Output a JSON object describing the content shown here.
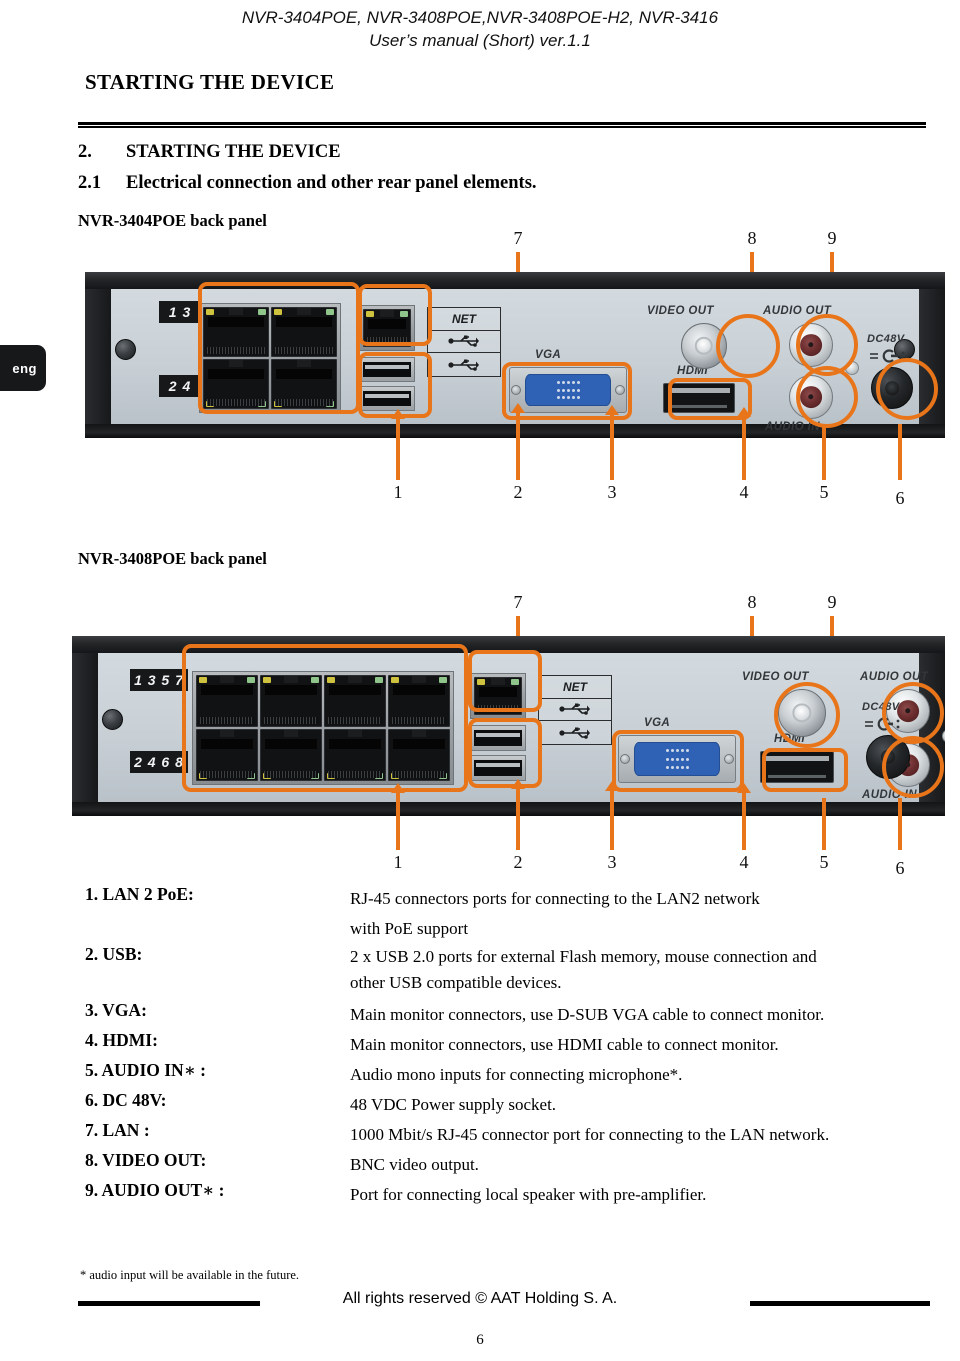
{
  "header": {
    "line1": "NVR-3404POE, NVR-3408POE,NVR-3408POE-H2, NVR-3416",
    "line2": "User’s manual (Short) ver.1.1"
  },
  "chapter_title": "STARTING THE DEVICE",
  "sections": [
    {
      "number": "2.",
      "title": "STARTING THE DEVICE"
    },
    {
      "number": "2.1",
      "title": "Electrical connection and other rear panel elements."
    }
  ],
  "language_tab": "eng",
  "panels": [
    {
      "caption": "NVR-3404POE back panel",
      "port_labels_top": "1 3",
      "port_labels_bottom": "2 4",
      "lan_ports": 4,
      "silkscreen": {
        "net": "NET",
        "vga": "VGA",
        "hdmi": "HDMI",
        "video_out": "VIDEO OUT",
        "audio_out": "AUDIO OUT",
        "audio_in": "AUDIO IN",
        "dc": "DC48V"
      },
      "callouts_top": [
        "7",
        "8",
        "9"
      ],
      "callouts_bottom": [
        "1",
        "2",
        "3",
        "4",
        "5",
        "6"
      ]
    },
    {
      "caption": "NVR-3408POE back panel",
      "port_labels_top": "1 3 5 7",
      "port_labels_bottom": "2 4 6 8",
      "lan_ports": 8,
      "silkscreen": {
        "net": "NET",
        "vga": "VGA",
        "hdmi": "HDMI",
        "video_out": "VIDEO OUT",
        "audio_out": "AUDIO OUT",
        "audio_in": "AUDIO IN",
        "dc": "DC48V"
      },
      "callouts_top": [
        "7",
        "8",
        "9"
      ],
      "callouts_bottom": [
        "1",
        "2",
        "3",
        "4",
        "5",
        "6"
      ]
    }
  ],
  "descriptions": [
    {
      "label": "1. LAN 2 PoE:",
      "text": "RJ-45 connectors ports for connecting to the LAN2 network",
      "text2": "with PoE support"
    },
    {
      "label": "2. USB:",
      "text": "2 x USB 2.0 ports for external Flash memory, mouse connection and",
      "text2": "other USB compatible devices."
    },
    {
      "label": "3. VGA:",
      "text": "Main monitor connectors, use D-SUB VGA cable to connect monitor.",
      "text2": ""
    },
    {
      "label": "4. HDMI:",
      "text": "Main monitor connectors, use HDMI cable to connect monitor.",
      "text2": ""
    },
    {
      "label": "5. AUDIO IN∗ :",
      "text": "Audio mono inputs for connecting microphone*.",
      "text2": ""
    },
    {
      "label": "6. DC 48V:",
      "text": "48 VDC Power supply socket.",
      "text2": ""
    },
    {
      "label": "7. LAN :",
      "text": "1000 Mbit/s RJ-45 connector port for connecting to the LAN network.",
      "text2": ""
    },
    {
      "label": "8. VIDEO OUT:",
      "text": "BNC video output.",
      "text2": ""
    },
    {
      "label": "9. AUDIO OUT∗ :",
      "text": "Port for connecting local speaker with pre-amplifier.",
      "text2": ""
    }
  ],
  "footer": {
    "footnote": "* audio input will be available in the future.",
    "copyright": "All rights reserved © AAT Holding S. A.",
    "page_number": "6"
  },
  "colors": {
    "annotation": "#E8751A",
    "panel_face": "#c8d0d6",
    "chassis": "#17181a"
  }
}
